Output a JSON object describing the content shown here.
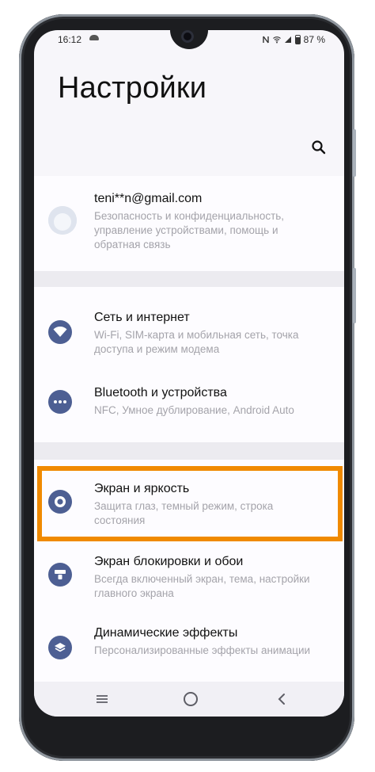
{
  "status_bar": {
    "time": "16:12",
    "battery": "87 %"
  },
  "page": {
    "title": "Настройки"
  },
  "account": {
    "email": "teni**n@gmail.com",
    "description": "Безопасность и конфиденциальность, управление устройствами, помощь и обратная связь"
  },
  "settings": {
    "items": [
      {
        "label": "Сеть и интернет",
        "description": "Wi-Fi, SIM-карта и мобильная сеть, точка доступа и режим модема",
        "icon": "wifi-icon"
      },
      {
        "label": "Bluetooth и устройства",
        "description": "NFC, Умное дублирование, Android Auto",
        "icon": "more-dots-icon"
      },
      {
        "label": "Экран и яркость",
        "description": "Защита глаз, темный режим, строка состояния",
        "icon": "brightness-icon",
        "highlighted": true
      },
      {
        "label": "Экран блокировки и обои",
        "description": "Всегда включенный экран, тема, настройки главного экрана",
        "icon": "lock-screen-icon"
      },
      {
        "label": "Динамические эффекты",
        "description": "Персонализированные эффекты анимации",
        "icon": "layers-icon"
      }
    ]
  },
  "colors": {
    "accent_highlight": "#f08a00",
    "icon_bg": "#4d5f93",
    "screen_bg": "#f7f6fa"
  }
}
